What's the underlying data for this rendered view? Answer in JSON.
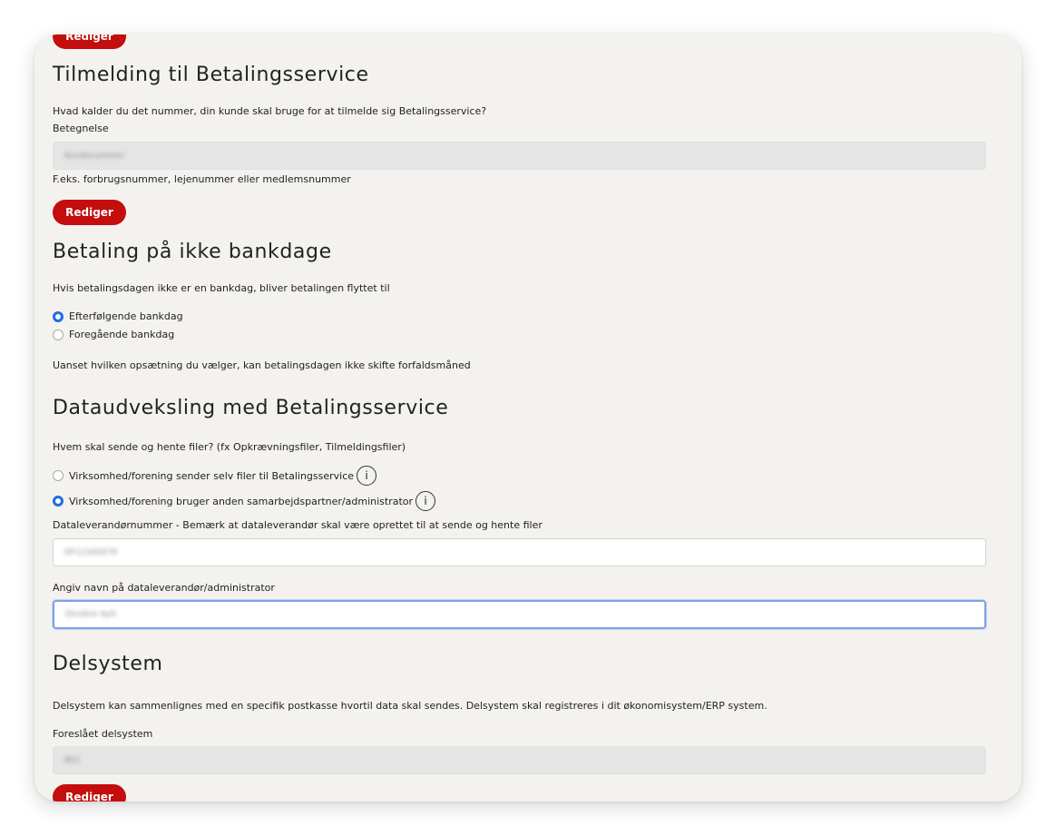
{
  "colors": {
    "accent": "#c40d0d",
    "radio_checked": "#1f6ce6",
    "focus_border": "#7fa0e6",
    "card_background": "#f3f2ee"
  },
  "edit_label": "Rediger",
  "info_icon_glyph": "i",
  "tilmelding": {
    "title": "Tilmelding til Betalingsservice",
    "question": "Hvad kalder du det nummer, din kunde skal bruge for at tilmelde sig Betalingsservice?",
    "field_label": "Betegnelse",
    "field_value": "Kundenummer",
    "hint": "F.eks. forbrugsnummer, lejenummer eller medlemsnummer"
  },
  "bankdage": {
    "title": "Betaling på ikke bankdage",
    "description": "Hvis betalingsdagen ikke er en bankdag, bliver betalingen flyttet til",
    "options": [
      {
        "label": "Efterfølgende bankdag",
        "checked": true
      },
      {
        "label": "Foregående bankdag",
        "checked": false
      }
    ],
    "note": "Uanset hvilken opsætning du vælger, kan betalingsdagen ikke skifte forfaldsmåned"
  },
  "dataudveksling": {
    "title": "Dataudveksling med Betalingsservice",
    "question": "Hvem skal sende og hente filer? (fx Opkrævningsfiler, Tilmeldingsfiler)",
    "options": [
      {
        "label": "Virksomhed/forening sender selv filer til Betalingsservice",
        "checked": false
      },
      {
        "label": "Virksomhed/forening bruger anden samarbejdspartner/administrator",
        "checked": true
      }
    ],
    "supplier_number_label": "Dataleverandørnummer - Bemærk at dataleverandør skal være oprettet til at sende og hente filer",
    "supplier_number_value": "DF12345678",
    "supplier_name_label": "Angiv navn på dataleverandør/administrator",
    "supplier_name_value": "Dinebre ApS"
  },
  "delsystem": {
    "title": "Delsystem",
    "description": "Delsystem kan sammenlignes med en specifik postkasse hvortil data skal sendes. Delsystem skal registreres i dit økonomisystem/ERP system.",
    "field_label": "Foreslået delsystem",
    "field_value": "BS1"
  }
}
